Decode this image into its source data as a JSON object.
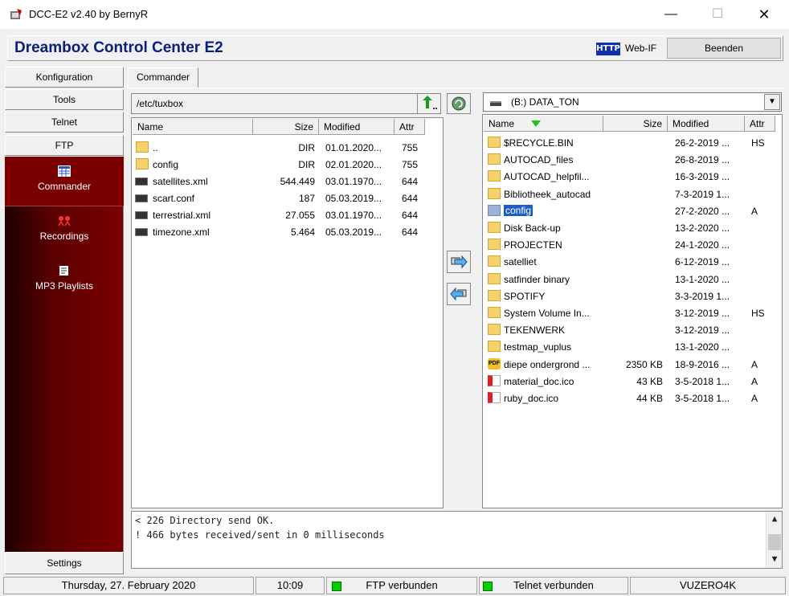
{
  "window": {
    "title": "DCC-E2 v2.40 by BernyR",
    "min": "—",
    "max": "☐",
    "close": "✕"
  },
  "header": {
    "title": "Dreambox Control Center E2",
    "http_badge": "HTTP",
    "webif_label": "Web-IF",
    "beenden_label": "Beenden"
  },
  "nav": {
    "konfiguration": "Konfiguration",
    "tools": "Tools",
    "telnet": "Telnet",
    "ftp": "FTP",
    "commander": "Commander",
    "recordings": "Recordings",
    "mp3": "MP3 Playlists",
    "settings": "Settings"
  },
  "tab": {
    "label": "Commander"
  },
  "left": {
    "path": "/etc/tuxbox",
    "headers": {
      "name": "Name",
      "size": "Size",
      "modified": "Modified",
      "attr": "Attr"
    },
    "rows": [
      {
        "name": "..",
        "size": "DIR",
        "modified": "01.01.2020...",
        "attr": "755",
        "type": "folder"
      },
      {
        "name": "config",
        "size": "DIR",
        "modified": "02.01.2020...",
        "attr": "755",
        "type": "folder"
      },
      {
        "name": "satellites.xml",
        "size": "544.449",
        "modified": "03.01.1970...",
        "attr": "644",
        "type": "file"
      },
      {
        "name": "scart.conf",
        "size": "187",
        "modified": "05.03.2019...",
        "attr": "644",
        "type": "file"
      },
      {
        "name": "terrestrial.xml",
        "size": "27.055",
        "modified": "03.01.1970...",
        "attr": "644",
        "type": "file"
      },
      {
        "name": "timezone.xml",
        "size": "5.464",
        "modified": "05.03.2019...",
        "attr": "644",
        "type": "file"
      }
    ]
  },
  "right": {
    "drive": "(B:)  DATA_TON",
    "headers": {
      "name": "Name",
      "size": "Size",
      "modified": "Modified",
      "attr": "Attr"
    },
    "rows": [
      {
        "name": "$RECYCLE.BIN",
        "size": "",
        "modified": "26-2-2019 ...",
        "attr": "HS",
        "type": "folder"
      },
      {
        "name": "AUTOCAD_files",
        "size": "",
        "modified": "26-8-2019 ...",
        "attr": "",
        "type": "folder"
      },
      {
        "name": "AUTOCAD_helpfil...",
        "size": "",
        "modified": "16-3-2019 ...",
        "attr": "",
        "type": "folder"
      },
      {
        "name": "Bibliotheek_autocad",
        "size": "",
        "modified": "7-3-2019 1...",
        "attr": "",
        "type": "folder"
      },
      {
        "name": "config",
        "size": "",
        "modified": "27-2-2020 ...",
        "attr": "A",
        "type": "folder-selected"
      },
      {
        "name": "Disk Back-up",
        "size": "",
        "modified": "13-2-2020 ...",
        "attr": "",
        "type": "folder"
      },
      {
        "name": "PROJECTEN",
        "size": "",
        "modified": "24-1-2020 ...",
        "attr": "",
        "type": "folder"
      },
      {
        "name": "satelliet",
        "size": "",
        "modified": "6-12-2019 ...",
        "attr": "",
        "type": "folder"
      },
      {
        "name": "satfinder binary",
        "size": "",
        "modified": "13-1-2020 ...",
        "attr": "",
        "type": "folder"
      },
      {
        "name": "SPOTIFY",
        "size": "",
        "modified": "3-3-2019 1...",
        "attr": "",
        "type": "folder"
      },
      {
        "name": "System Volume In...",
        "size": "",
        "modified": "3-12-2019 ...",
        "attr": "HS",
        "type": "folder"
      },
      {
        "name": "TEKENWERK",
        "size": "",
        "modified": "3-12-2019 ...",
        "attr": "",
        "type": "folder"
      },
      {
        "name": "testmap_vuplus",
        "size": "",
        "modified": "13-1-2020 ...",
        "attr": "",
        "type": "folder"
      },
      {
        "name": "diepe ondergrond ...",
        "size": "2350 KB",
        "modified": "18-9-2016 ...",
        "attr": "A",
        "type": "pdf"
      },
      {
        "name": "material_doc.ico",
        "size": "43 KB",
        "modified": "3-5-2018 1...",
        "attr": "A",
        "type": "ico"
      },
      {
        "name": "ruby_doc.ico",
        "size": "44 KB",
        "modified": "3-5-2018 1...",
        "attr": "A",
        "type": "ico"
      }
    ]
  },
  "log": {
    "lines": [
      "< 226 Directory send OK.",
      "! 466 bytes received/sent in 0 milliseconds"
    ]
  },
  "status": {
    "date": "Thursday, 27. February 2020",
    "time": "10:09",
    "ftp": "FTP verbunden",
    "telnet": "Telnet verbunden",
    "box": "VUZERO4K"
  },
  "icons": {
    "folder": "folder-icon",
    "file": "file-icon",
    "pdf": "pdf-icon",
    "ico": "image-file-icon"
  }
}
